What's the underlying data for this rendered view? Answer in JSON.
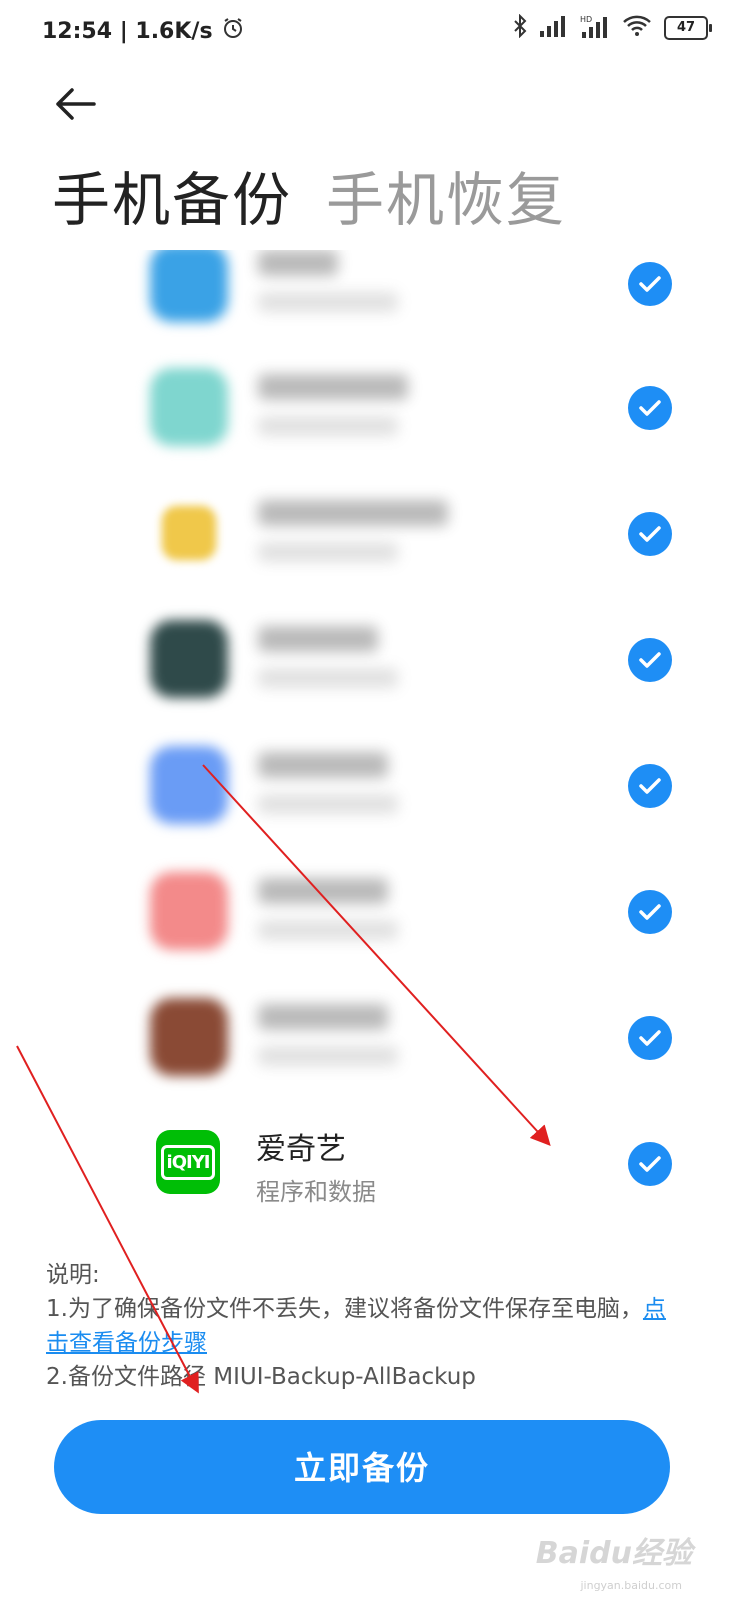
{
  "status_bar": {
    "time_speed": "12:54 | 1.6K/s",
    "battery_level": "47",
    "icons": [
      "alarm-icon",
      "bluetooth-icon",
      "signal-icon",
      "hd-signal-icon",
      "wifi-icon",
      "battery-icon"
    ]
  },
  "tabs": [
    {
      "label": "手机备份",
      "active": true
    },
    {
      "label": "手机恢复",
      "active": false
    }
  ],
  "apps": {
    "blurred_icon_colors": [
      "#3aa2e6",
      "#7fd6cf",
      "#f0c84a",
      "#2f4a4a",
      "#6a9cf5",
      "#f38a8a",
      "#8a4a35"
    ],
    "last_app": {
      "name": "爱奇艺",
      "subtitle": "程序和数据",
      "icon_text": "iQIYI"
    }
  },
  "notes": {
    "heading": "说明:",
    "line1": "1.为了确保备份文件不丢失，建议将备份文件保存至电脑，",
    "link": "点击查看备份步骤",
    "line2": "2.备份文件路径 MIUI-Backup-AllBackup"
  },
  "backup_button_label": "立即备份",
  "watermark": {
    "text": "Baidu经验",
    "sub": "jingyan.baidu.com"
  },
  "colors": {
    "accent": "#1e8ef5",
    "arrow": "#e02020"
  }
}
